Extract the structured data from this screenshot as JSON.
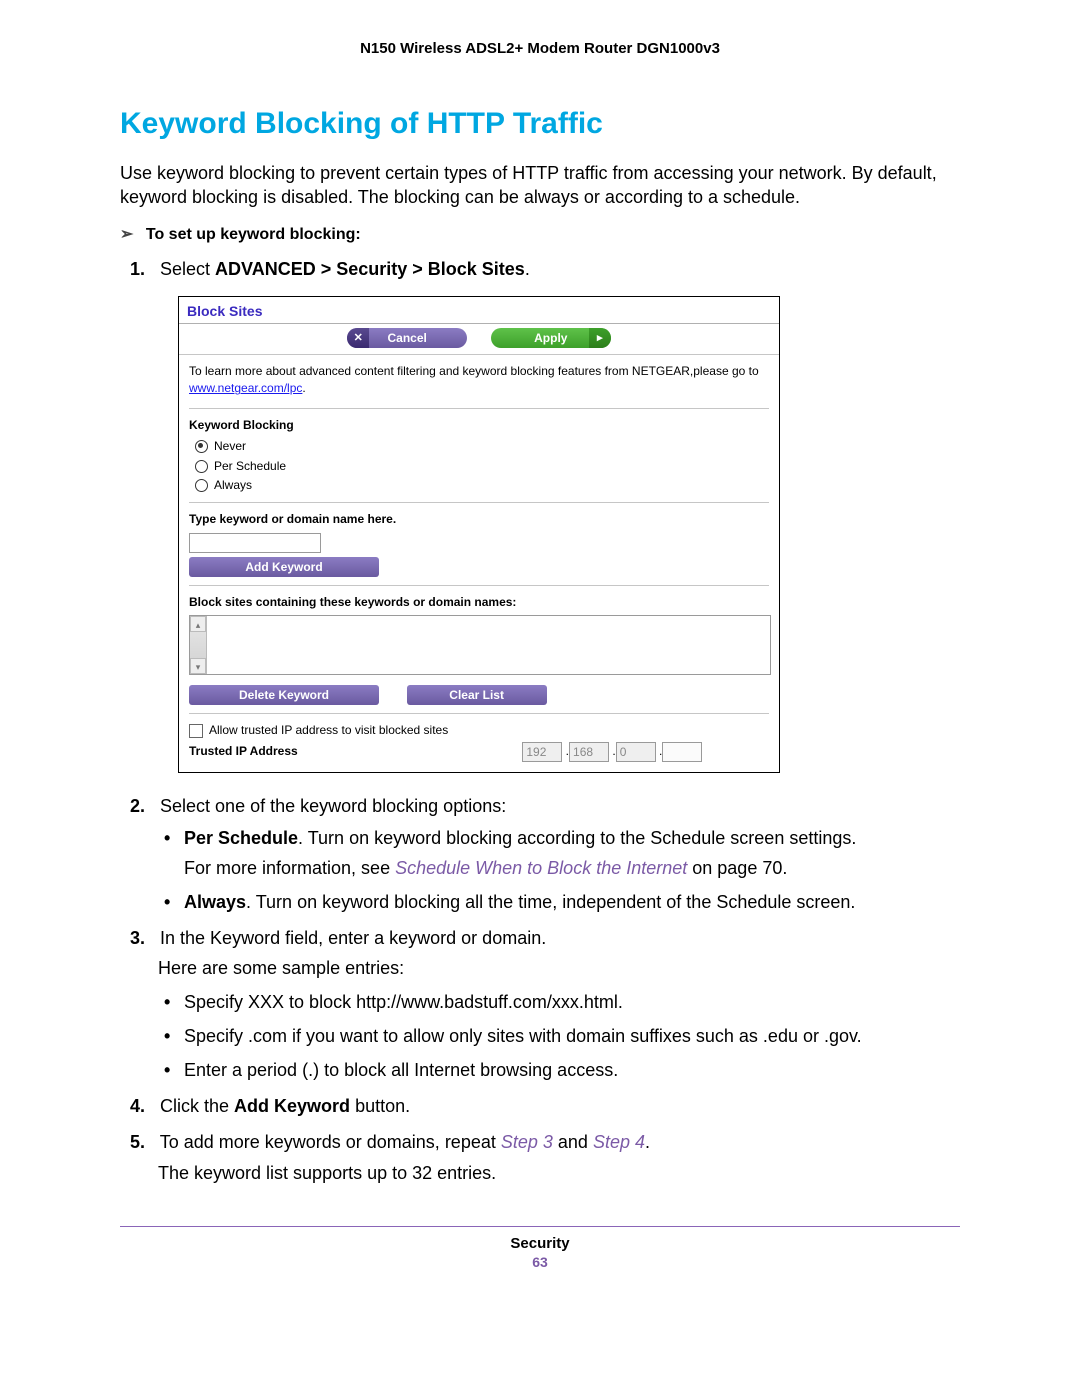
{
  "header": {
    "title": "N150 Wireless ADSL2+ Modem Router DGN1000v3"
  },
  "heading": "Keyword Blocking of HTTP Traffic",
  "intro": "Use keyword blocking to prevent certain types of HTTP traffic from accessing your network. By default, keyword blocking is disabled. The blocking can be always or according to a schedule.",
  "procHeading": "To set up keyword blocking:",
  "steps": {
    "s1_a": "Select ",
    "s1_bold": "ADVANCED > Security > Block Sites",
    "s1_c": ".",
    "s2": "Select one of the keyword blocking options:",
    "s2_b1_a": "Per Schedule",
    "s2_b1_b": ". Turn on keyword blocking according to the Schedule screen settings.",
    "s2_b1_sub_a": "For more information, see ",
    "s2_b1_sub_link": "Schedule When to Block the Internet",
    "s2_b1_sub_b": " on page 70.",
    "s2_b2_a": "Always",
    "s2_b2_b": ". Turn on keyword blocking all the time, independent of the Schedule screen.",
    "s3_a": "In the Keyword field, enter a keyword or domain.",
    "s3_intro": "Here are some sample entries:",
    "s3_b1": "Specify XXX to block http://www.badstuff.com/xxx.html.",
    "s3_b2": "Specify .com if you want to allow only sites with domain suffixes such as .edu or .gov.",
    "s3_b3": "Enter a period (.) to block all Internet browsing access.",
    "s4_a": "Click the ",
    "s4_bold": "Add Keyword",
    "s4_b": " button.",
    "s5_a": "To add more keywords or domains, repeat ",
    "s5_step3": "Step 3",
    "s5_mid": " and ",
    "s5_step4": "Step 4",
    "s5_c": ".",
    "s5_sub": "The keyword list supports up to 32 entries."
  },
  "ui": {
    "title": "Block Sites",
    "cancel": "Cancel",
    "cancel_x": "✕",
    "apply": "Apply",
    "apply_arrow": "▸",
    "info_a": "To learn more about advanced content filtering and keyword blocking features from NETGEAR,please go to ",
    "info_link": "www.netgear.com/lpc",
    "info_b": ".",
    "kb_label": "Keyword Blocking",
    "r_never": "Never",
    "r_sched": "Per Schedule",
    "r_always": "Always",
    "type_label": "Type keyword or domain name here.",
    "add_btn": "Add Keyword",
    "block_list_label": "Block sites containing these keywords or domain names:",
    "up": "▴",
    "dn": "▾",
    "del_btn": "Delete Keyword",
    "clr_btn": "Clear List",
    "trust_chk": "Allow trusted IP address to visit blocked sites",
    "trust_lbl": "Trusted IP Address",
    "ip1": "192",
    "ip2": "168",
    "ip3": "0",
    "ip4": ""
  },
  "footer": {
    "section": "Security",
    "page": "63"
  }
}
